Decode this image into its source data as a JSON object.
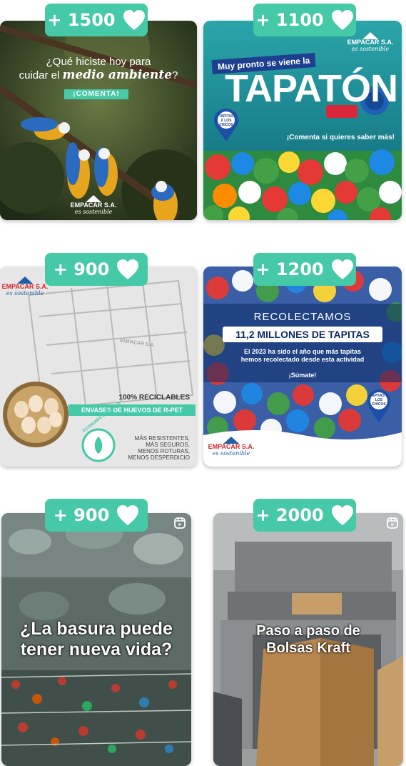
{
  "posts": [
    {
      "likes": "+ 1500",
      "headline_line1": "¿Qué hiciste hoy para",
      "headline_line2_a": "cuidar el ",
      "headline_line2_b": "medio ambiente",
      "headline_line2_c": "?",
      "cta": "¡COMENTA!",
      "brand": "EMPACAR S.A.",
      "brand_tagline": "es sostenible"
    },
    {
      "likes": "+ 1100",
      "pre_title": "Muy pronto se viene la",
      "title": "TAPATÓN",
      "cta": "¡Comenta si quieres saber más!",
      "pin_label": "TAPITAS X LOS CHICOS",
      "brand": "EMPACAR S.A.",
      "brand_tagline": "es sostenible"
    },
    {
      "likes": "+ 900",
      "brand": "EMPACAR S.A.",
      "brand_tagline": "es sostenible",
      "tray_label": "EMPACAR S.A.",
      "line1": "100% RECICLABLES",
      "line2": "ENVASES DE HUEVOS DE R-PET",
      "circle_label": "ECONOMÍA CIRCULAR",
      "benefits": [
        "MÁS RESISTENTES,",
        "MÁS SEGUROS,",
        "MENOS ROTURAS,",
        "MENOS DESPERDICIO"
      ]
    },
    {
      "likes": "+ 1200",
      "title_small": "RECOLECTAMOS",
      "title_big": "11,2 MILLONES DE TAPITAS",
      "body_line1": "El 2023 ha sido el año que más tapitas",
      "body_line2": "hemos recolectado desde esta actividad",
      "cta": "¡Súmate!",
      "pin_label": "TAPITAS X LOS CHICOS",
      "brand": "EMPACAR S.A.",
      "brand_tagline": "es sostenible"
    },
    {
      "likes": "+ 900",
      "headline_line1": "¿La basura puede",
      "headline_line2": "tener nueva vida?"
    },
    {
      "likes": "+ 2000",
      "headline_line1": "Paso a paso de",
      "headline_line2": "Bolsas Kraft"
    }
  ],
  "icons": {
    "badge": "heart-icon",
    "reel": "reels-icon"
  },
  "colors": {
    "badge_bg": "#45c9a6",
    "brand_blue": "#1f5fa8",
    "brand_red": "#d8232a"
  }
}
